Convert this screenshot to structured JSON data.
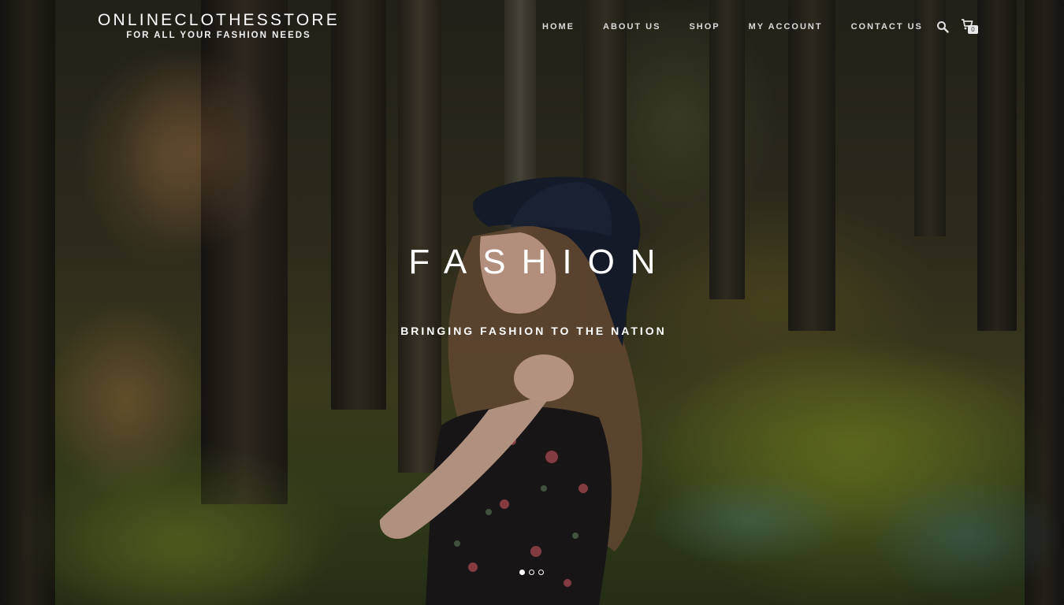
{
  "brand": {
    "title": "ONLINECLOTHESSTORE",
    "tagline": "FOR ALL YOUR FASHION NEEDS"
  },
  "nav": {
    "items": [
      {
        "label": "HOME"
      },
      {
        "label": "ABOUT US"
      },
      {
        "label": "SHOP"
      },
      {
        "label": "MY ACCOUNT"
      },
      {
        "label": "CONTACT US"
      }
    ]
  },
  "icons": {
    "search": "search-icon",
    "cart": "cart-icon"
  },
  "cart": {
    "count": "0"
  },
  "hero": {
    "title": "FASHION",
    "subtitle": "BRINGING FASHION TO THE NATION"
  },
  "slider": {
    "slide_count": 3,
    "active_index": 0
  },
  "colors": {
    "text": "#ffffff",
    "nav_text": "#dadada"
  }
}
